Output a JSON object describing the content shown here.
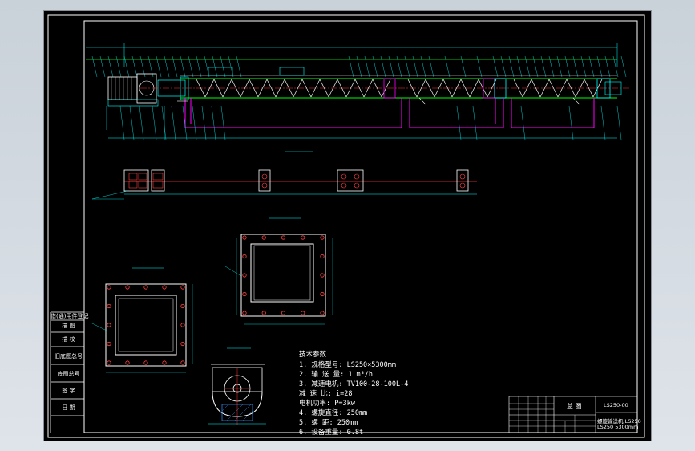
{
  "side_table": {
    "rows": [
      "借(通)用件登记",
      "描 图",
      "描 校",
      "旧底图总号",
      "底图总号",
      "签 字",
      "日 期"
    ]
  },
  "specs": {
    "title": "技术参数",
    "lines": [
      "1. 规格型号: LS250×5300mm",
      "2. 输 送 量: 1 m³/h",
      "3. 减速电机: TV100-28-100L-4",
      "   减 速 比: i=28",
      "   电机功率: P=3kw",
      "4. 螺旋直径: 250mm",
      "5. 螺    距: 250mm",
      "6. 设备重量: 0.8t"
    ]
  },
  "title_block": {
    "drawing_no": "LS250-00",
    "name_cn": "总 图",
    "name_line1": "螺旋输送机 LS250",
    "name_line2": "LS250  5300mm"
  },
  "colors": {
    "outline": "#ffffff",
    "conveyor": "#00ff00",
    "dimension": "#00ffff",
    "trough": "#ff00ff",
    "centerline": "#ff3030",
    "bolts": "#ff4040",
    "hatch": "#3399ff"
  }
}
